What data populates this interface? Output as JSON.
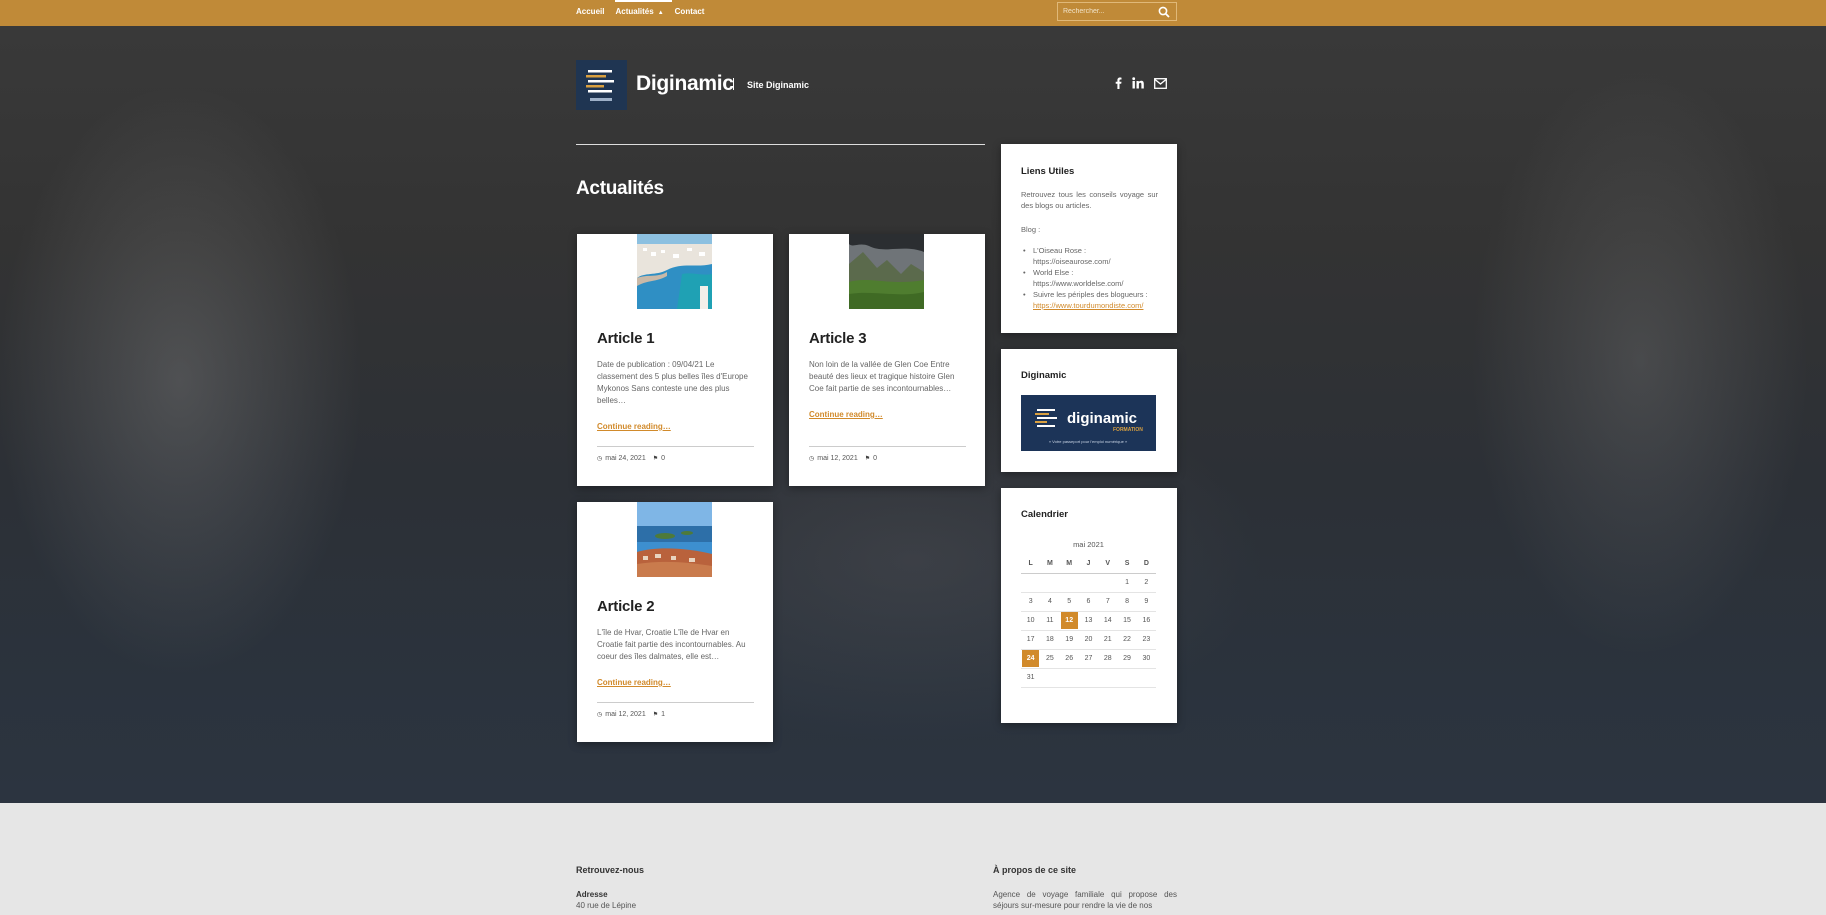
{
  "nav": {
    "items": [
      "Accueil",
      "Actualités",
      "Contact"
    ]
  },
  "search": {
    "placeholder": "Rechercher..."
  },
  "header": {
    "site_title": "Diginamic",
    "tagline": "Site Diginamic"
  },
  "social": [
    "facebook-icon",
    "linkedin-icon",
    "envelope-icon"
  ],
  "page": {
    "heading": "Actualités"
  },
  "posts": [
    {
      "title": "Article 1",
      "excerpt": "Date de publication : 09/04/21 Le classement des 5 plus belles îles d'Europe Mykonos Sans conteste une des plus belles…",
      "more": "Continue reading…",
      "date": "mai 24, 2021",
      "comments": "0"
    },
    {
      "title": "Article 3",
      "excerpt": "Non loin de la vallée de Glen Coe Entre beauté des lieux et tragique histoire Glen Coe fait partie de ses incontournables…",
      "more": "Continue reading…",
      "date": "mai 12, 2021",
      "comments": "0"
    },
    {
      "title": "Article 2",
      "excerpt": "L'île de Hvar, Croatie L'île de Hvar en Croatie fait partie des incontournables. Au coeur des îles dalmates, elle est…",
      "more": "Continue reading…",
      "date": "mai 12, 2021",
      "comments": "1"
    }
  ],
  "sidebar": {
    "links_widget": {
      "title": "Liens Utiles",
      "intro": "Retrouvez tous les conseils voyage sur des blogs ou articles.",
      "blog_label": "Blog :",
      "items": [
        {
          "label": "L'Oiseau Rose :",
          "url": "https://oiseaurose.com/"
        },
        {
          "label": "World Else :",
          "url": "https://www.worldelse.com/"
        },
        {
          "label": "Suivre les périples des blogueurs :",
          "url": "https://www.tourdumondiste.com/"
        }
      ]
    },
    "brand_widget": {
      "title": "Diginamic",
      "banner_main": "diginamic",
      "banner_sub": "FORMATION",
      "banner_tagline": "« Votre passeport pour l'emploi numérique »"
    },
    "calendar": {
      "title": "Calendrier",
      "caption": "mai 2021",
      "days": [
        "L",
        "M",
        "M",
        "J",
        "V",
        "S",
        "D"
      ],
      "weeks": [
        [
          "",
          "",
          "",
          "",
          "",
          "1",
          "2"
        ],
        [
          "3",
          "4",
          "5",
          "6",
          "7",
          "8",
          "9"
        ],
        [
          "10",
          "11",
          "12",
          "13",
          "14",
          "15",
          "16"
        ],
        [
          "17",
          "18",
          "19",
          "20",
          "21",
          "22",
          "23"
        ],
        [
          "24",
          "25",
          "26",
          "27",
          "28",
          "29",
          "30"
        ],
        [
          "31",
          "",
          "",
          "",
          "",
          "",
          ""
        ]
      ],
      "highlighted": [
        "12",
        "24"
      ]
    }
  },
  "footer": {
    "left_title": "Retrouvez-nous",
    "address_label": "Adresse",
    "address_line": "40 rue de Lépine",
    "right_title": "À propos de ce site",
    "about_text": "Agence de voyage familiale qui propose des séjours sur-mesure pour rendre la vie de nos"
  },
  "colors": {
    "accent": "#c08a38",
    "link": "#d18a2b",
    "logo_bg": "#1f3552"
  }
}
